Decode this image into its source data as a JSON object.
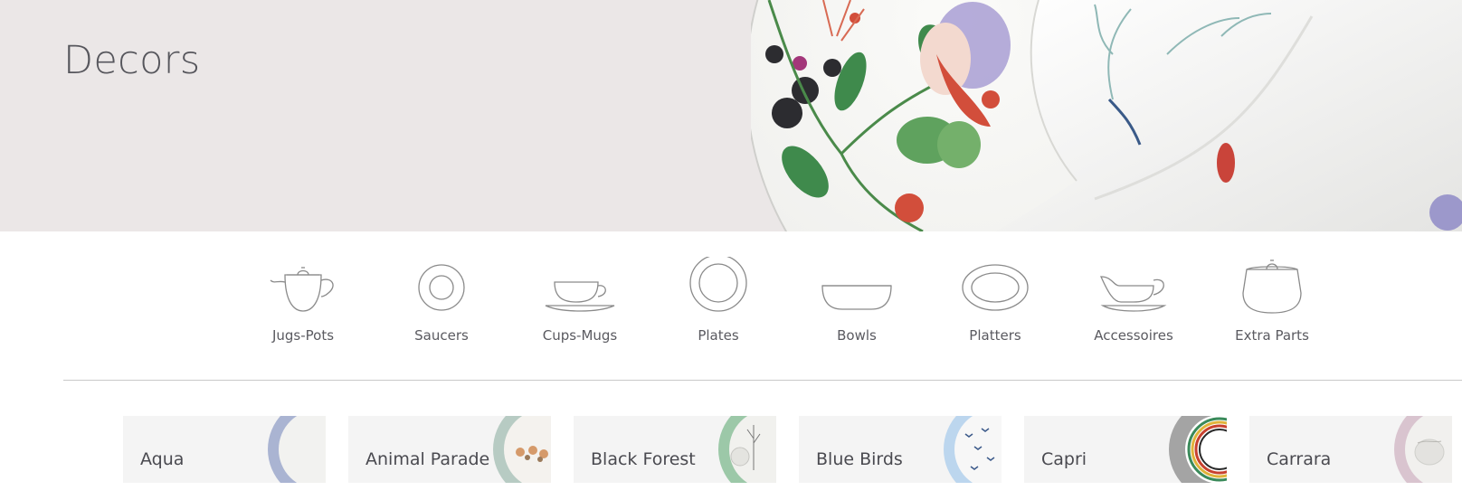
{
  "hero": {
    "title": "Decors"
  },
  "categories": [
    {
      "label": "Jugs-Pots",
      "icon": "teapot-icon"
    },
    {
      "label": "Saucers",
      "icon": "saucer-icon"
    },
    {
      "label": "Cups-Mugs",
      "icon": "cup-icon"
    },
    {
      "label": "Plates",
      "icon": "plate-icon"
    },
    {
      "label": "Bowls",
      "icon": "bowl-icon"
    },
    {
      "label": "Platters",
      "icon": "platter-icon"
    },
    {
      "label": "Accessoires",
      "icon": "gravy-boat-icon"
    },
    {
      "label": "Extra Parts",
      "icon": "sugar-bowl-icon"
    }
  ],
  "decors": [
    {
      "name": "Aqua",
      "accent": "#aab4d2"
    },
    {
      "name": "Animal Parade",
      "accent": "#b7cbc3"
    },
    {
      "name": "Black Forest",
      "accent": "#9cc8a8"
    },
    {
      "name": "Blue Birds",
      "accent": "#bcd6ee"
    },
    {
      "name": "Capri",
      "accent": "#a4a4a4"
    },
    {
      "name": "Carrara",
      "accent": "#d9c4cf"
    }
  ],
  "colors": {
    "hero_bg": "#ebe7e7",
    "tile_bg": "#f4f4f4",
    "text": "#56565c"
  }
}
